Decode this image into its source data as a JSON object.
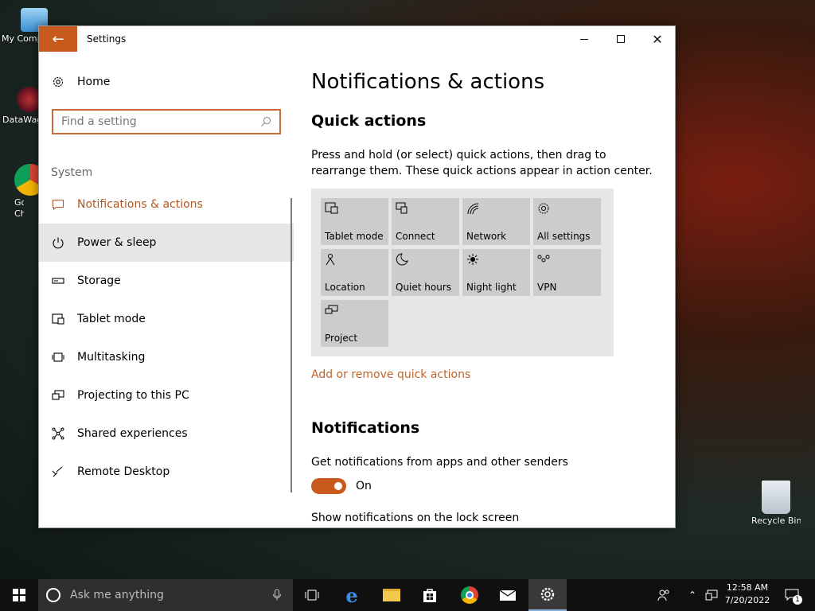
{
  "desktop": {
    "icons": [
      {
        "label": "My Comp"
      },
      {
        "label": "DataWag"
      },
      {
        "label": "Goog Chrom"
      },
      {
        "label": "Recycle Bin"
      }
    ]
  },
  "window": {
    "title": "Settings",
    "back_icon": "arrow-left-icon",
    "controls": [
      "minimize-icon",
      "maximize-icon",
      "close-icon"
    ]
  },
  "sidebar": {
    "home_label": "Home",
    "search_placeholder": "Find a setting",
    "section_label": "System",
    "items": [
      {
        "label": "Notifications & actions",
        "icon": "notification-icon",
        "active": true
      },
      {
        "label": "Power & sleep",
        "icon": "power-icon"
      },
      {
        "label": "Storage",
        "icon": "storage-icon"
      },
      {
        "label": "Tablet mode",
        "icon": "tablet-icon"
      },
      {
        "label": "Multitasking",
        "icon": "multitasking-icon"
      },
      {
        "label": "Projecting to this PC",
        "icon": "projecting-icon"
      },
      {
        "label": "Shared experiences",
        "icon": "shared-icon"
      },
      {
        "label": "Remote Desktop",
        "icon": "remote-desktop-icon"
      }
    ]
  },
  "main": {
    "page_title": "Notifications & actions",
    "quick_actions_heading": "Quick actions",
    "quick_actions_desc": "Press and hold (or select) quick actions, then drag to rearrange them. These quick actions appear in action center.",
    "tiles": [
      {
        "label": "Tablet mode",
        "icon": "tablet-mode-icon"
      },
      {
        "label": "Connect",
        "icon": "connect-icon"
      },
      {
        "label": "Network",
        "icon": "network-icon"
      },
      {
        "label": "All settings",
        "icon": "gear-icon"
      },
      {
        "label": "Location",
        "icon": "location-icon"
      },
      {
        "label": "Quiet hours",
        "icon": "moon-icon"
      },
      {
        "label": "Night light",
        "icon": "sun-icon"
      },
      {
        "label": "VPN",
        "icon": "vpn-icon"
      },
      {
        "label": "Project",
        "icon": "project-icon"
      }
    ],
    "add_remove_link": "Add or remove quick actions",
    "notifications_heading": "Notifications",
    "get_notifications_label": "Get notifications from apps and other senders",
    "toggle_state": "On",
    "lock_screen_label": "Show notifications on the lock screen"
  },
  "taskbar": {
    "search_placeholder": "Ask me anything",
    "time": "12:58 AM",
    "date": "7/20/2022",
    "notification_count": "1",
    "accent": "#c85a1e"
  }
}
